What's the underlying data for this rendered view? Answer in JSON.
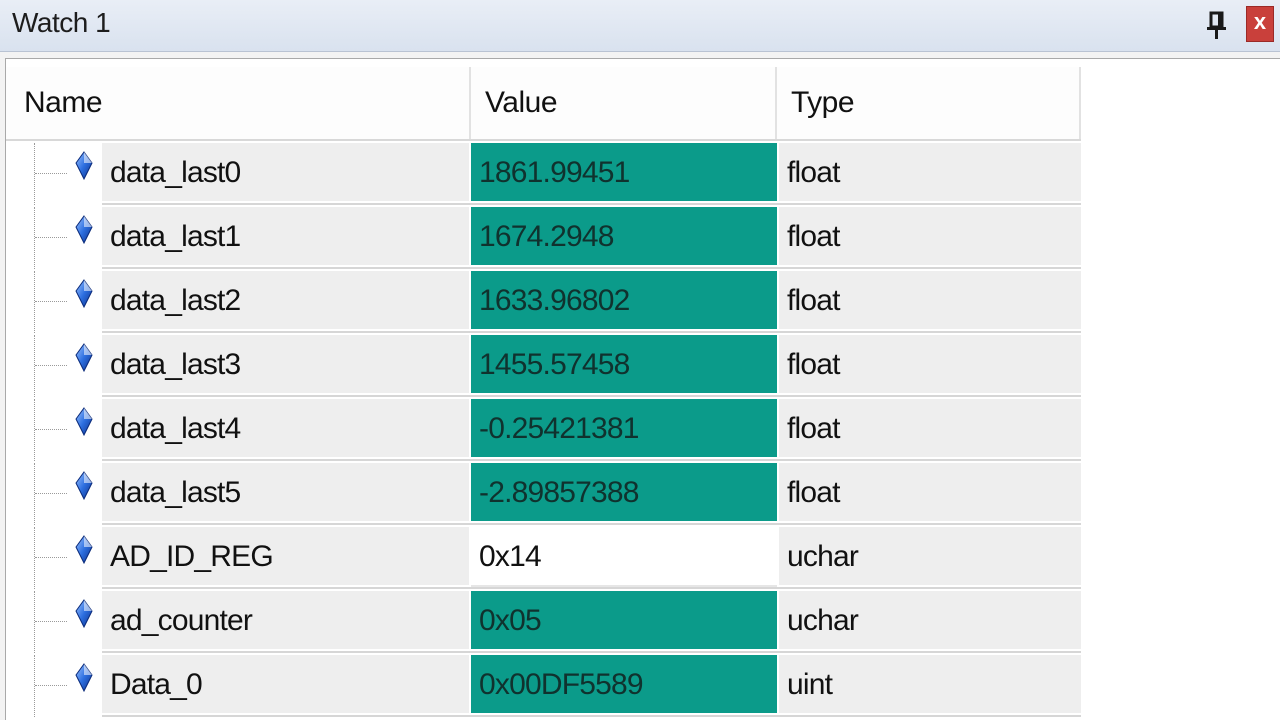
{
  "window": {
    "title": "Watch 1",
    "colors": {
      "highlight_value_bg": "#0b9b8a",
      "close_button_bg": "#c9403b",
      "cell_bg": "#eeeeee"
    },
    "icons": [
      "pin-icon",
      "close-icon",
      "variable-diamond-icon"
    ]
  },
  "table": {
    "headers": {
      "name": "Name",
      "value": "Value",
      "type": "Type"
    },
    "rows": [
      {
        "name": "data_last0",
        "value": "1861.99451",
        "type": "float",
        "changed": true
      },
      {
        "name": "data_last1",
        "value": "1674.2948",
        "type": "float",
        "changed": true
      },
      {
        "name": "data_last2",
        "value": "1633.96802",
        "type": "float",
        "changed": true
      },
      {
        "name": "data_last3",
        "value": "1455.57458",
        "type": "float",
        "changed": true
      },
      {
        "name": "data_last4",
        "value": "-0.25421381",
        "type": "float",
        "changed": true
      },
      {
        "name": "data_last5",
        "value": "-2.89857388",
        "type": "float",
        "changed": true
      },
      {
        "name": "AD_ID_REG",
        "value": "0x14",
        "type": "uchar",
        "changed": false
      },
      {
        "name": "ad_counter",
        "value": "0x05",
        "type": "uchar",
        "changed": true
      },
      {
        "name": "Data_0",
        "value": "0x00DF5589",
        "type": "uint",
        "changed": true
      }
    ]
  }
}
